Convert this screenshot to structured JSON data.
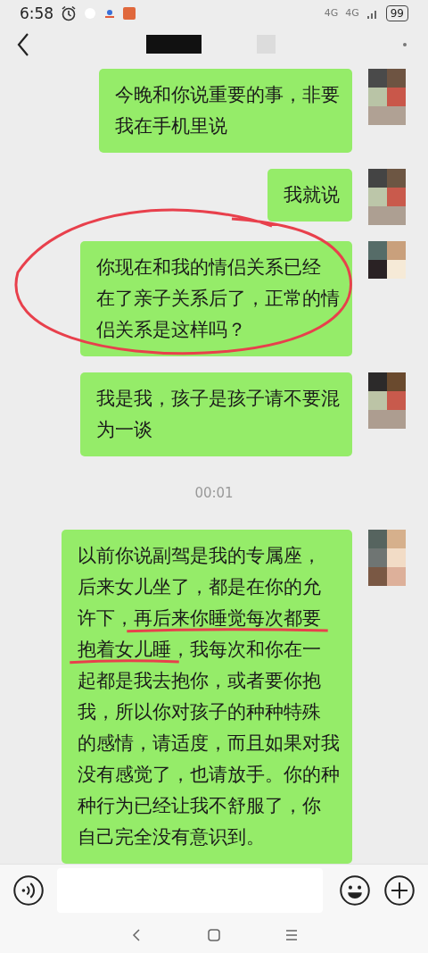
{
  "status_bar": {
    "time": "6:58",
    "network_1": "4G",
    "network_2": "4G",
    "battery": "99"
  },
  "messages": [
    {
      "kind": "text",
      "circled": false,
      "lines": [
        {
          "text": "今晚和你说重要的事，非要"
        },
        {
          "text": "我在手机里说"
        }
      ]
    },
    {
      "kind": "text",
      "circled": false,
      "lines": [
        {
          "text": "我就说"
        }
      ]
    },
    {
      "kind": "text",
      "circled": true,
      "lines": [
        {
          "text": "你现在和我的情侣关系已经"
        },
        {
          "text": "在了亲子关系后了，正常的情"
        },
        {
          "text": "侣关系是这样吗？"
        }
      ]
    },
    {
      "kind": "text",
      "circled": false,
      "lines": [
        {
          "text": "我是我，孩子是孩子请不要混"
        },
        {
          "text": "为一谈"
        }
      ]
    },
    {
      "kind": "time",
      "text": "00:01"
    },
    {
      "kind": "text",
      "circled": false,
      "lines": [
        {
          "text": "以前你说副驾是我的专属座，"
        },
        {
          "text": "后来女儿坐了，都是在你的允"
        },
        {
          "segments": [
            {
              "text": "许下，",
              "underlined": false
            },
            {
              "text": "再后来你睡觉每次都要",
              "underlined": true
            }
          ]
        },
        {
          "segments": [
            {
              "text": "抱着女儿睡",
              "underlined": true
            },
            {
              "text": "，我每次和你在一",
              "underlined": false
            }
          ]
        },
        {
          "text": "起都是我去抱你，或者要你抱"
        },
        {
          "text": "我，所以你对孩子的种种特殊"
        },
        {
          "text": "的感情，请适度，而且如果对我"
        },
        {
          "text": "没有感觉了，也请放手。你的种"
        },
        {
          "text": "种行为已经让我不舒服了，你"
        },
        {
          "text": "自己完全没有意识到。"
        }
      ]
    }
  ]
}
